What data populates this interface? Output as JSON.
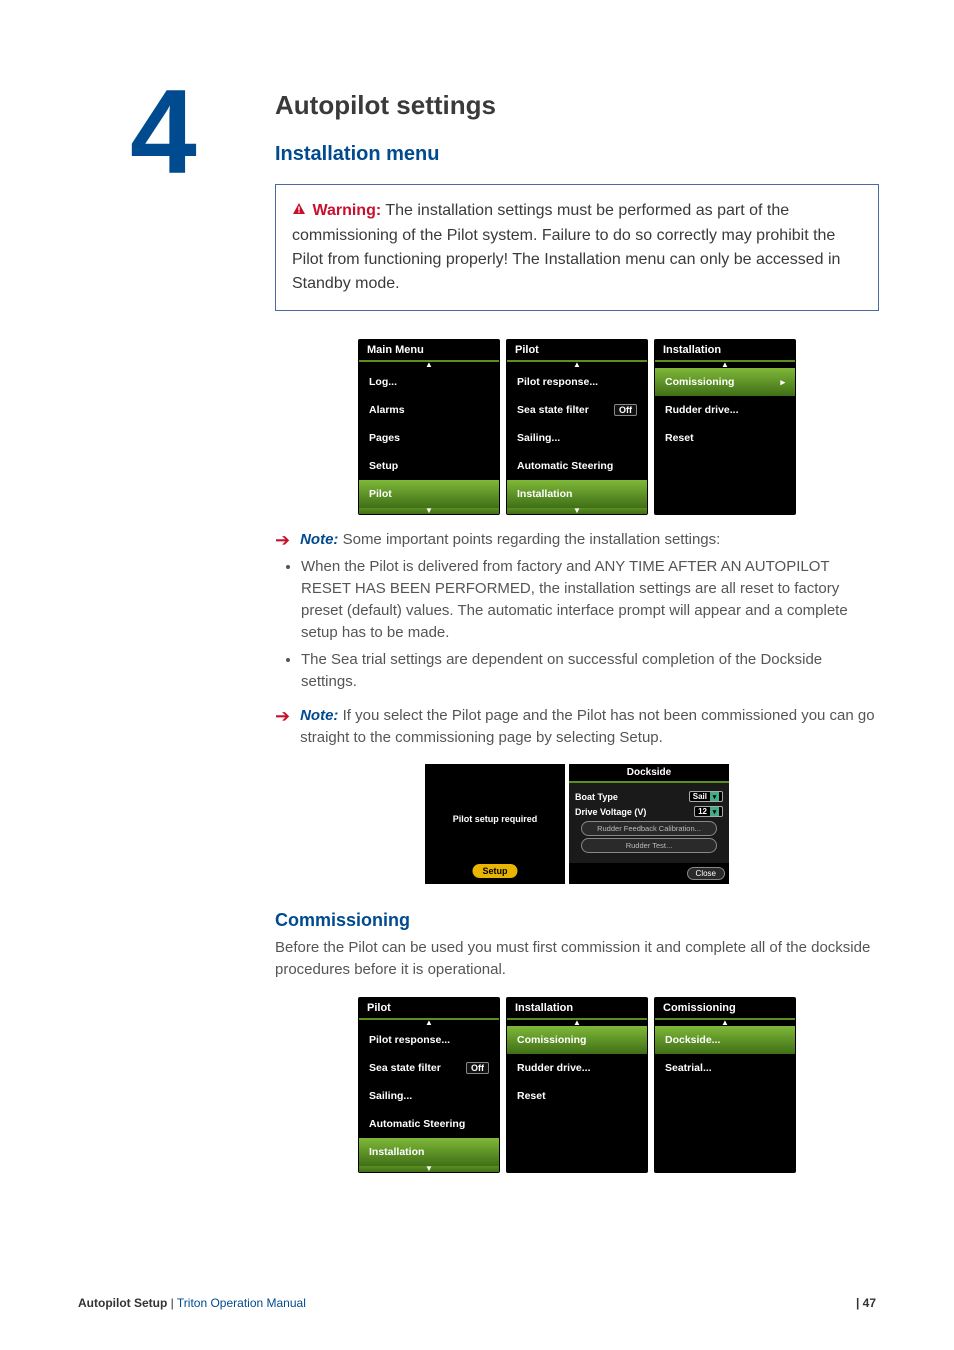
{
  "chapter_number": "4",
  "h1": "Autopilot settings",
  "h2_installation": "Installation menu",
  "warning": {
    "label": "Warning:",
    "text": "The installation settings must be performed as part of the commissioning of the Pilot system. Failure to do so correctly may prohibit the Pilot from functioning properly! The Installation menu can only be accessed in Standby mode."
  },
  "menus_top": {
    "main": {
      "title": "Main Menu",
      "items": [
        "Log...",
        "Alarms",
        "Pages",
        "Setup",
        "Pilot"
      ],
      "selected": "Pilot"
    },
    "pilot": {
      "title": "Pilot",
      "items": [
        {
          "label": "Pilot response..."
        },
        {
          "label": "Sea state filter",
          "value": "Off"
        },
        {
          "label": "Sailing..."
        },
        {
          "label": "Automatic Steering"
        },
        {
          "label": "Installation"
        }
      ],
      "selected": "Installation"
    },
    "installation": {
      "title": "Installation",
      "items": [
        "Comissioning",
        "Rudder drive...",
        "Reset"
      ],
      "selected": "Comissioning"
    }
  },
  "note1": {
    "label": "Note:",
    "text": "Some important points regarding the installation settings:"
  },
  "bullets": [
    "When the Pilot is delivered from factory and ANY TIME AFTER AN AUTOPILOT RESET HAS BEEN PERFORMED, the installation settings are all reset to factory preset (default) values. The automatic interface prompt will appear and a complete setup has to be made.",
    "The Sea trial settings are dependent on successful completion of the Dockside settings."
  ],
  "note2": {
    "label": "Note:",
    "text": "If you select the Pilot page and the Pilot has not been commissioned you can go straight to the commissioning page by selecting Setup."
  },
  "dockside": {
    "left_msg": "Pilot setup required",
    "setup_btn": "Setup",
    "dlg_title": "Dockside",
    "boat_type_label": "Boat Type",
    "boat_type_value": "Sail",
    "drive_v_label": "Drive Voltage (V)",
    "drive_v_value": "12",
    "btn_calib": "Rudder Feedback Calibration...",
    "btn_test": "Rudder Test...",
    "close": "Close"
  },
  "h3_comm": "Commissioning",
  "comm_para": "Before the Pilot can be used you must first commission it and complete all of the dockside procedures before it is operational.",
  "menus_bottom": {
    "pilot": {
      "title": "Pilot",
      "items": [
        {
          "label": "Pilot response..."
        },
        {
          "label": "Sea state filter",
          "value": "Off"
        },
        {
          "label": "Sailing..."
        },
        {
          "label": "Automatic Steering"
        },
        {
          "label": "Installation"
        }
      ],
      "selected": "Installation"
    },
    "installation": {
      "title": "Installation",
      "items": [
        "Comissioning",
        "Rudder drive...",
        "Reset"
      ],
      "selected": "Comissioning"
    },
    "commissioning": {
      "title": "Comissioning",
      "items": [
        "Dockside...",
        "Seatrial..."
      ],
      "selected": "Dockside..."
    }
  },
  "footer": {
    "section": "Autopilot Setup",
    "manual": "Triton Operation Manual",
    "page": "| 47"
  }
}
